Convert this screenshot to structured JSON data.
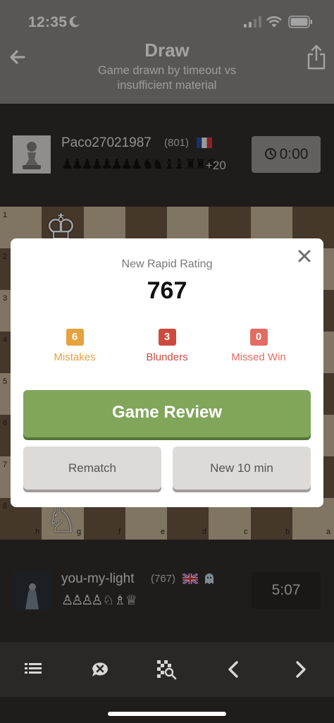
{
  "status_bar": {
    "time": "12:35"
  },
  "header": {
    "title": "Draw",
    "subtitle": "Game drawn by timeout vs insufficient material"
  },
  "opponent": {
    "name": "Paco27021987",
    "rating": "(801)",
    "flag": "France",
    "captured": "♟♟♟♟♟♟♟♟ ♞♞ ♝♝ ♜♜ ♛",
    "material_diff": "+20",
    "clock": "0:00"
  },
  "me": {
    "name": "you-my-light",
    "rating": "(767)",
    "flag": "United Kingdom",
    "captured": "♙♙♙♙ ♘ ♗ ♕",
    "clock": "5:07"
  },
  "board": {
    "ranks": [
      "1",
      "2",
      "3",
      "4",
      "5",
      "6",
      "7",
      "8"
    ],
    "files": [
      "h",
      "g",
      "f",
      "e",
      "d",
      "c",
      "b",
      "a"
    ]
  },
  "modal": {
    "caption": "New Rapid Rating",
    "rating": "767",
    "stats": [
      {
        "count": "6",
        "label": "Mistakes",
        "color": "#e6a23c"
      },
      {
        "count": "3",
        "label": "Blunders",
        "color": "#cf4a3e"
      },
      {
        "count": "0",
        "label": "Missed Win",
        "color": "#e26b63"
      }
    ],
    "review_label": "Game Review",
    "rematch_label": "Rematch",
    "new_game_label": "New 10 min"
  },
  "toolbar": {
    "icons": [
      "list-icon",
      "analysis-off-icon",
      "board-search-icon",
      "chevron-left-icon",
      "chevron-right-icon"
    ]
  },
  "colors": {
    "review_green": "#81a65a",
    "board_light": "#c9b89a",
    "board_dark": "#6e5644"
  }
}
